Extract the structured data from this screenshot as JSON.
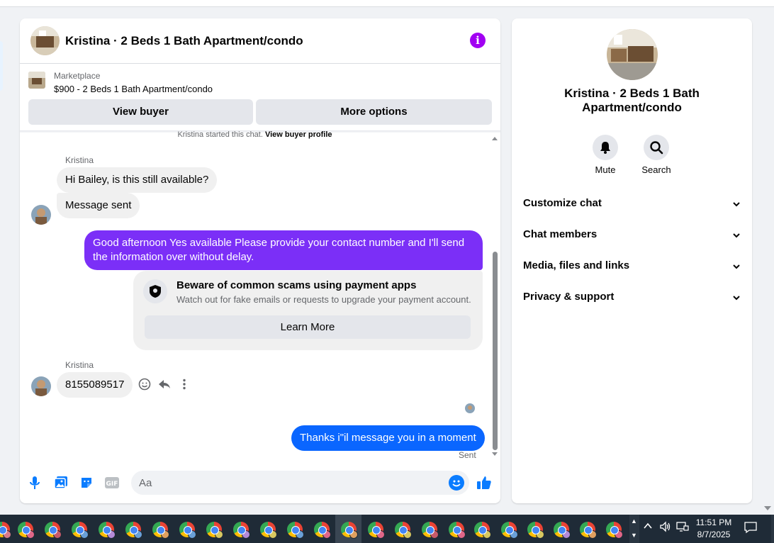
{
  "chat": {
    "title": "Kristina · 2 Beds 1 Bath Apartment/condo",
    "marketplace_label": "Marketplace",
    "listing_title": "$900 - 2 Beds 1 Bath Apartment/condo",
    "view_buyer_label": "View buyer",
    "more_options_label": "More options",
    "started_prefix": "Kristina started this chat. ",
    "started_link": "View buyer profile"
  },
  "messages": {
    "sender_1": "Kristina",
    "msg_1": "Hi Bailey, is this still available?",
    "msg_2": "Message sent",
    "msg_3": "Good afternoon Yes available Please provide your contact number and I'll send the information over without delay.",
    "scam_title": "Beware of common scams using payment apps",
    "scam_subtitle": "Watch out for fake emails or requests to upgrade your payment account.",
    "learn_more_label": "Learn More",
    "sender_2": "Kristina",
    "msg_4": "8155089517",
    "msg_5": "Thanks i\"il message you in a moment",
    "sent_status": "Sent"
  },
  "composer": {
    "placeholder": "Aa"
  },
  "info_panel": {
    "title": "Kristina · 2 Beds 1 Bath Apartment/condo",
    "mute_label": "Mute",
    "search_label": "Search",
    "sections": [
      "Customize chat",
      "Chat members",
      "Media, files and links",
      "Privacy & support"
    ]
  },
  "taskbar": {
    "time": "11:51 PM",
    "date": "8/7/2025"
  },
  "colors": {
    "accent_purple": "#7b2ff7",
    "accent_blue": "#0a66ff",
    "info_purple": "#a100f2",
    "taskbar_bg": "#1f2b37"
  },
  "icons": [
    "info-icon",
    "shield-icon",
    "smile-icon",
    "reply-icon",
    "more-vertical-icon",
    "microphone-icon",
    "image-icon",
    "sticker-icon",
    "gif-icon",
    "emoji-icon",
    "like-thumb-icon",
    "bell-icon",
    "search-icon",
    "chevron-down-icon",
    "chrome-profile-icon",
    "volume-icon",
    "network-icon",
    "notification-icon"
  ]
}
